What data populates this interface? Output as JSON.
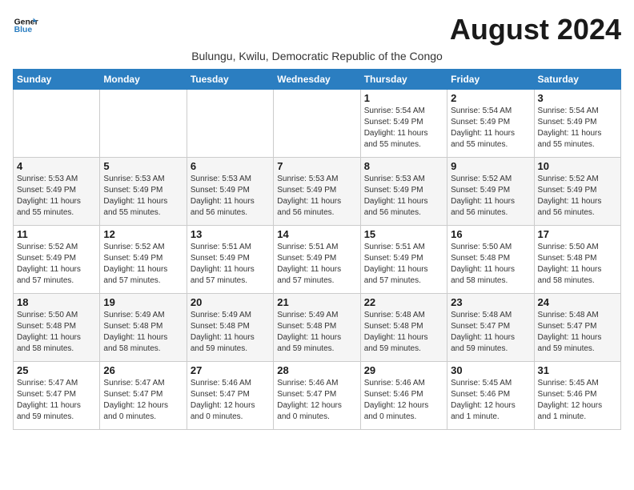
{
  "header": {
    "logo_line1": "General",
    "logo_line2": "Blue",
    "month_title": "August 2024",
    "subtitle": "Bulungu, Kwilu, Democratic Republic of the Congo"
  },
  "days_of_week": [
    "Sunday",
    "Monday",
    "Tuesday",
    "Wednesday",
    "Thursday",
    "Friday",
    "Saturday"
  ],
  "weeks": [
    [
      {
        "day": "",
        "info": ""
      },
      {
        "day": "",
        "info": ""
      },
      {
        "day": "",
        "info": ""
      },
      {
        "day": "",
        "info": ""
      },
      {
        "day": "1",
        "info": "Sunrise: 5:54 AM\nSunset: 5:49 PM\nDaylight: 11 hours\nand 55 minutes."
      },
      {
        "day": "2",
        "info": "Sunrise: 5:54 AM\nSunset: 5:49 PM\nDaylight: 11 hours\nand 55 minutes."
      },
      {
        "day": "3",
        "info": "Sunrise: 5:54 AM\nSunset: 5:49 PM\nDaylight: 11 hours\nand 55 minutes."
      }
    ],
    [
      {
        "day": "4",
        "info": "Sunrise: 5:53 AM\nSunset: 5:49 PM\nDaylight: 11 hours\nand 55 minutes."
      },
      {
        "day": "5",
        "info": "Sunrise: 5:53 AM\nSunset: 5:49 PM\nDaylight: 11 hours\nand 55 minutes."
      },
      {
        "day": "6",
        "info": "Sunrise: 5:53 AM\nSunset: 5:49 PM\nDaylight: 11 hours\nand 56 minutes."
      },
      {
        "day": "7",
        "info": "Sunrise: 5:53 AM\nSunset: 5:49 PM\nDaylight: 11 hours\nand 56 minutes."
      },
      {
        "day": "8",
        "info": "Sunrise: 5:53 AM\nSunset: 5:49 PM\nDaylight: 11 hours\nand 56 minutes."
      },
      {
        "day": "9",
        "info": "Sunrise: 5:52 AM\nSunset: 5:49 PM\nDaylight: 11 hours\nand 56 minutes."
      },
      {
        "day": "10",
        "info": "Sunrise: 5:52 AM\nSunset: 5:49 PM\nDaylight: 11 hours\nand 56 minutes."
      }
    ],
    [
      {
        "day": "11",
        "info": "Sunrise: 5:52 AM\nSunset: 5:49 PM\nDaylight: 11 hours\nand 57 minutes."
      },
      {
        "day": "12",
        "info": "Sunrise: 5:52 AM\nSunset: 5:49 PM\nDaylight: 11 hours\nand 57 minutes."
      },
      {
        "day": "13",
        "info": "Sunrise: 5:51 AM\nSunset: 5:49 PM\nDaylight: 11 hours\nand 57 minutes."
      },
      {
        "day": "14",
        "info": "Sunrise: 5:51 AM\nSunset: 5:49 PM\nDaylight: 11 hours\nand 57 minutes."
      },
      {
        "day": "15",
        "info": "Sunrise: 5:51 AM\nSunset: 5:49 PM\nDaylight: 11 hours\nand 57 minutes."
      },
      {
        "day": "16",
        "info": "Sunrise: 5:50 AM\nSunset: 5:48 PM\nDaylight: 11 hours\nand 58 minutes."
      },
      {
        "day": "17",
        "info": "Sunrise: 5:50 AM\nSunset: 5:48 PM\nDaylight: 11 hours\nand 58 minutes."
      }
    ],
    [
      {
        "day": "18",
        "info": "Sunrise: 5:50 AM\nSunset: 5:48 PM\nDaylight: 11 hours\nand 58 minutes."
      },
      {
        "day": "19",
        "info": "Sunrise: 5:49 AM\nSunset: 5:48 PM\nDaylight: 11 hours\nand 58 minutes."
      },
      {
        "day": "20",
        "info": "Sunrise: 5:49 AM\nSunset: 5:48 PM\nDaylight: 11 hours\nand 59 minutes."
      },
      {
        "day": "21",
        "info": "Sunrise: 5:49 AM\nSunset: 5:48 PM\nDaylight: 11 hours\nand 59 minutes."
      },
      {
        "day": "22",
        "info": "Sunrise: 5:48 AM\nSunset: 5:48 PM\nDaylight: 11 hours\nand 59 minutes."
      },
      {
        "day": "23",
        "info": "Sunrise: 5:48 AM\nSunset: 5:47 PM\nDaylight: 11 hours\nand 59 minutes."
      },
      {
        "day": "24",
        "info": "Sunrise: 5:48 AM\nSunset: 5:47 PM\nDaylight: 11 hours\nand 59 minutes."
      }
    ],
    [
      {
        "day": "25",
        "info": "Sunrise: 5:47 AM\nSunset: 5:47 PM\nDaylight: 11 hours\nand 59 minutes."
      },
      {
        "day": "26",
        "info": "Sunrise: 5:47 AM\nSunset: 5:47 PM\nDaylight: 12 hours\nand 0 minutes."
      },
      {
        "day": "27",
        "info": "Sunrise: 5:46 AM\nSunset: 5:47 PM\nDaylight: 12 hours\nand 0 minutes."
      },
      {
        "day": "28",
        "info": "Sunrise: 5:46 AM\nSunset: 5:47 PM\nDaylight: 12 hours\nand 0 minutes."
      },
      {
        "day": "29",
        "info": "Sunrise: 5:46 AM\nSunset: 5:46 PM\nDaylight: 12 hours\nand 0 minutes."
      },
      {
        "day": "30",
        "info": "Sunrise: 5:45 AM\nSunset: 5:46 PM\nDaylight: 12 hours\nand 1 minute."
      },
      {
        "day": "31",
        "info": "Sunrise: 5:45 AM\nSunset: 5:46 PM\nDaylight: 12 hours\nand 1 minute."
      }
    ]
  ]
}
